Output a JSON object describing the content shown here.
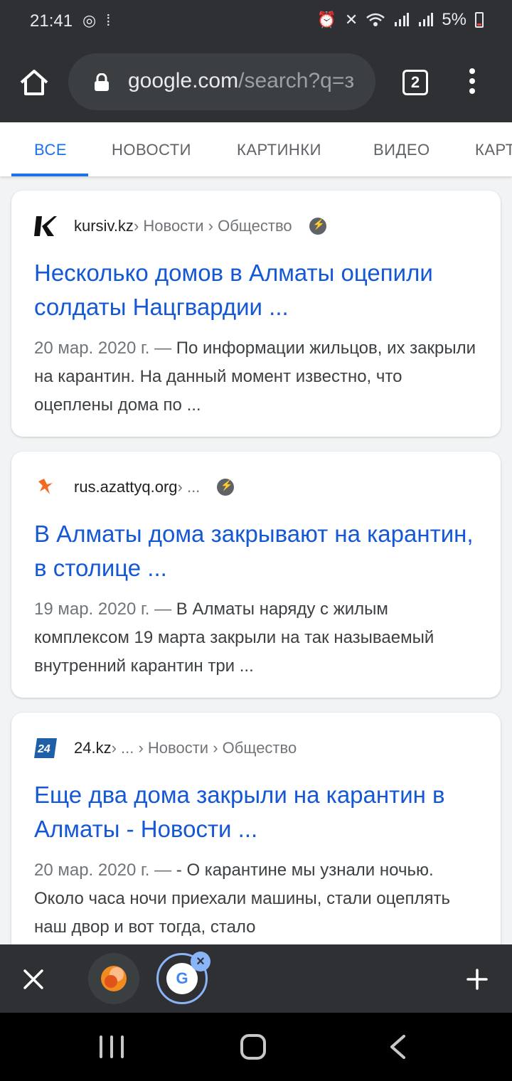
{
  "status_bar": {
    "time": "21:41",
    "battery": "5%",
    "icons": [
      "location-icon",
      "footsteps-icon",
      "alarm-icon",
      "mute-icon",
      "wifi-icon",
      "signal-icon",
      "signal-icon",
      "battery-icon"
    ]
  },
  "toolbar": {
    "url_host": "google.com",
    "url_rest": "/search?q=з",
    "tab_count": "2"
  },
  "search_tabs": [
    {
      "label": "ВСЕ",
      "active": true
    },
    {
      "label": "НОВОСТИ",
      "active": false
    },
    {
      "label": "КАРТИНКИ",
      "active": false
    },
    {
      "label": "ВИДЕО",
      "active": false
    },
    {
      "label": "КАРТЫ",
      "active": false
    }
  ],
  "results": [
    {
      "site": "kursiv.kz",
      "crumbs": " › Новости › Общество",
      "favicon": "kursiv-logo",
      "title": "Несколько домов в Алматы оцепили солдаты Нацгвардии ...",
      "date": "20 мар. 2020 г. — ",
      "snippet": "По информации жильцов, их закрыли на карантин. На данный момент известно, что оцеплены дома по ..."
    },
    {
      "site": "rus.azattyq.org",
      "crumbs": " › ...",
      "favicon": "azattyq-logo",
      "title": "В Алматы дома закрывают на карантин, в столице ...",
      "date": "19 мар. 2020 г. — ",
      "snippet": "В Алматы наряду с жилым комплексом 19 марта закрыли на так называемый внутренний карантин три ..."
    },
    {
      "site": "24.kz",
      "crumbs": " › ... › Новости › Общество",
      "favicon": "24kz-logo",
      "title": "Еще два дома закрыли на карантин в Алматы - Новости ...",
      "date": "20 мар. 2020 г. — ",
      "snippet": "- О карантине мы узнали ночью. Около часа ночи приехали машины, стали оцеплять наш двор и вот тогда, стало"
    }
  ],
  "tab_strip": {
    "google_letter": "G"
  }
}
